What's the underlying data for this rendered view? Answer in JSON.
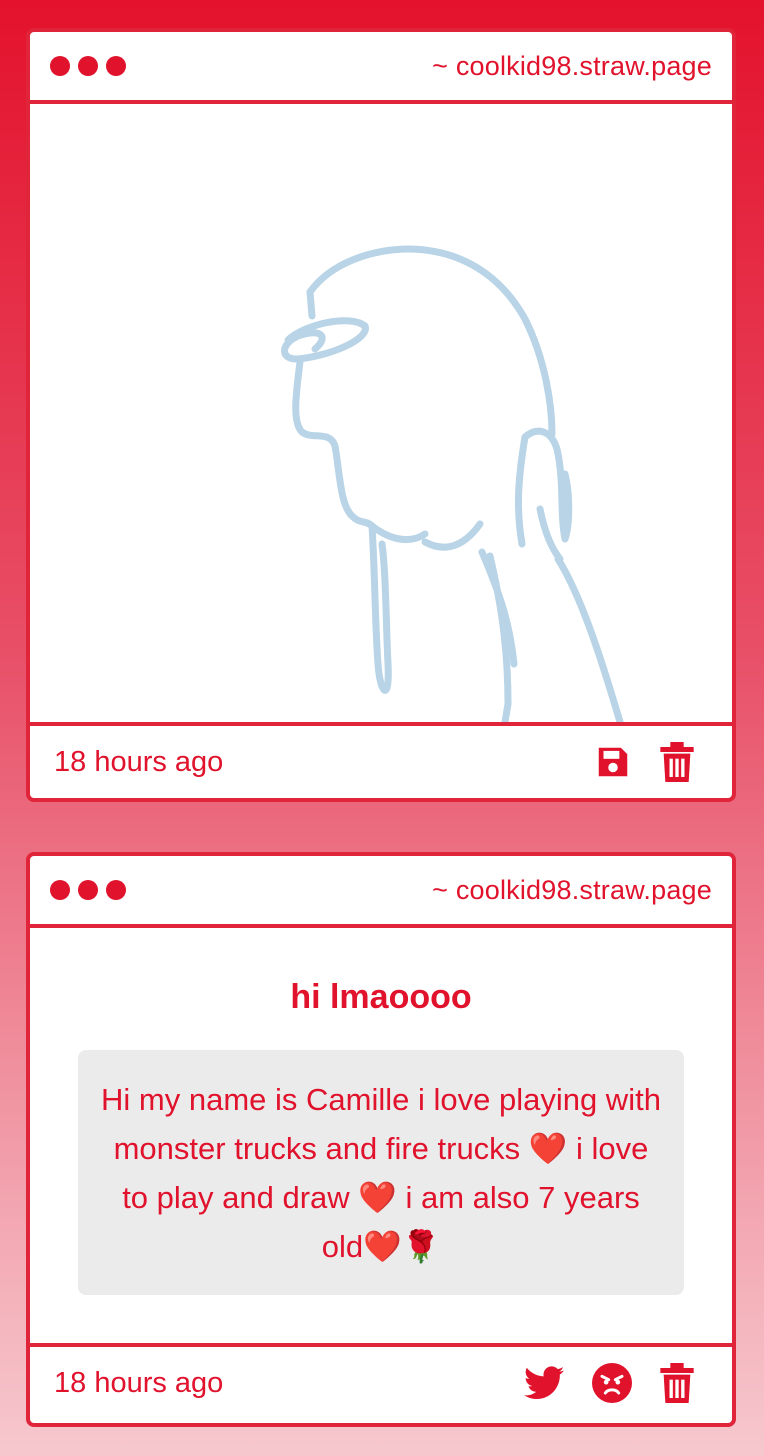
{
  "posts": [
    {
      "url": "~ coolkid98.straw.page",
      "type": "drawing",
      "drawing_color": "#b8d4e6",
      "timestamp": "18 hours ago",
      "actions": [
        "save-icon",
        "trash-icon"
      ]
    },
    {
      "url": "~ coolkid98.straw.page",
      "type": "text",
      "title": "hi lmaoooo",
      "body": "Hi my name is Camille i love playing with monster trucks and fire trucks ❤️ i love to play and draw ❤️ i am also 7 years old❤️🌹",
      "timestamp": "18 hours ago",
      "actions": [
        "twitter-icon",
        "angry-face-icon",
        "trash-icon"
      ]
    }
  ],
  "colors": {
    "accent": "#e0122c",
    "border": "#e0243a",
    "body_box": "#ecebec"
  }
}
